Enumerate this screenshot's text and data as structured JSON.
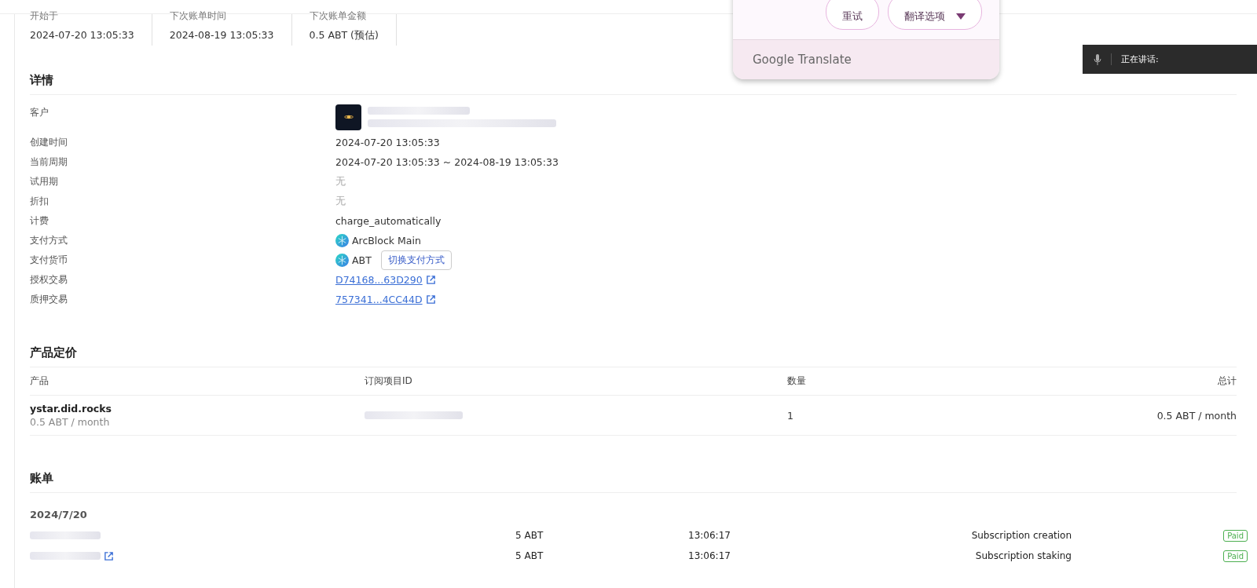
{
  "summary": [
    {
      "label": "开始于",
      "value": "2024-07-20 13:05:33"
    },
    {
      "label": "下次账单时间",
      "value": "2024-08-19 13:05:33"
    },
    {
      "label": "下次账单金额",
      "value": "0.5 ABT (预估)"
    }
  ],
  "details": {
    "title": "详情",
    "rows": [
      {
        "kind": "customer",
        "label": "客户"
      },
      {
        "kind": "text",
        "label": "创建时间",
        "value": "2024-07-20 13:05:33"
      },
      {
        "kind": "text",
        "label": "当前周期",
        "value": "2024-07-20 13:05:33 ~ 2024-08-19 13:05:33"
      },
      {
        "kind": "muted",
        "label": "试用期",
        "value": "无"
      },
      {
        "kind": "muted",
        "label": "折扣",
        "value": "无"
      },
      {
        "kind": "text",
        "label": "计费",
        "value": "charge_automatically"
      },
      {
        "kind": "token",
        "label": "支付方式",
        "value": "ArcBlock Main"
      },
      {
        "kind": "token",
        "label": "支付货币",
        "value": "ABT",
        "action": "切换支付方式"
      },
      {
        "kind": "link",
        "label": "授权交易",
        "value": "D74168...63D290"
      },
      {
        "kind": "link",
        "label": "质押交易",
        "value": "757341...4CC44D"
      }
    ]
  },
  "pricing": {
    "title": "产品定价",
    "columns": [
      "产品",
      "订阅项目ID",
      "数量",
      "总计"
    ],
    "rows": [
      {
        "product": "ystar.did.rocks",
        "price": "0.5 ABT / month",
        "quantity": "1",
        "total": "0.5 ABT / month"
      }
    ]
  },
  "invoices": {
    "title": "账单",
    "date": "2024/7/20",
    "rows": [
      {
        "link": false,
        "amount": "5 ABT",
        "time": "13:06:17",
        "description": "Subscription creation",
        "status": "Paid"
      },
      {
        "link": true,
        "amount": "5 ABT",
        "time": "13:06:17",
        "description": "Subscription staking",
        "status": "Paid"
      }
    ]
  },
  "translate_popup": {
    "buttons": [
      "重试",
      "翻译选项"
    ],
    "footer": "Google Translate"
  },
  "speech_bar": {
    "label": "正在讲话:"
  }
}
